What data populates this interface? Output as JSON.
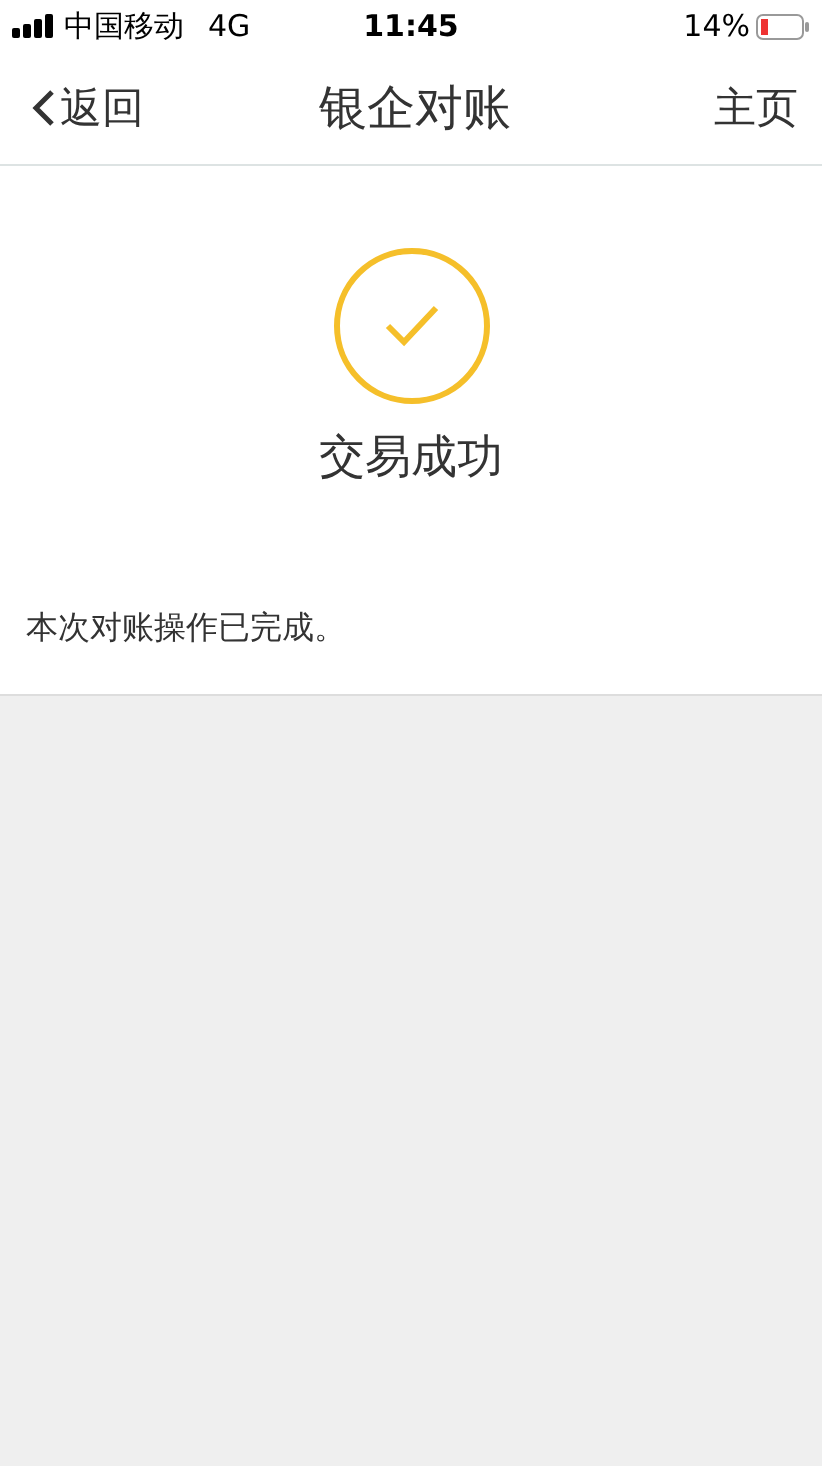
{
  "status_bar": {
    "carrier": "中国移动",
    "network": "4G",
    "time": "11:45",
    "battery": "14%"
  },
  "nav_bar": {
    "back": "返回",
    "title": "银企对账",
    "home": "主页"
  },
  "result": {
    "title": "交易成功",
    "message": "本次对账操作已完成。"
  }
}
